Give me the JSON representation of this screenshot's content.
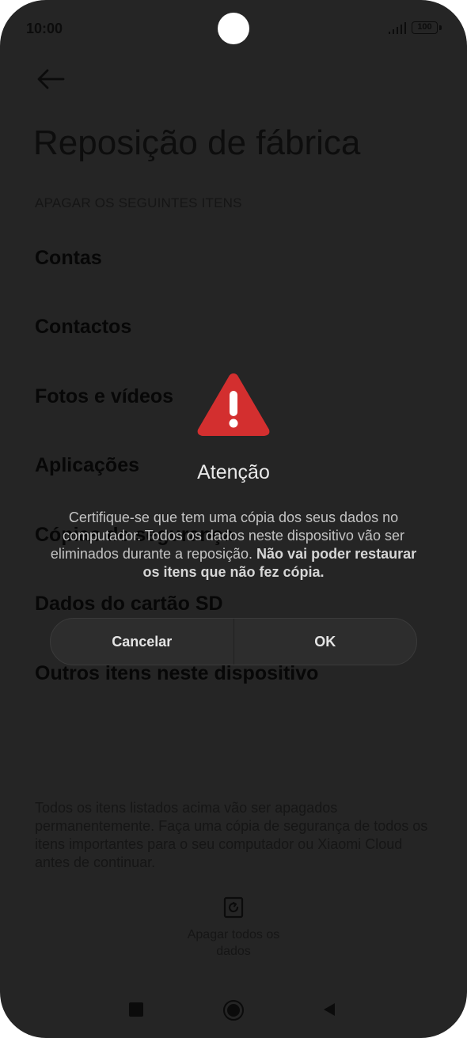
{
  "status_bar": {
    "time": "10:00",
    "battery": "100"
  },
  "page": {
    "title": "Reposição de fábrica",
    "section_header": "APAGAR OS SEGUINTES ITENS",
    "items": [
      "Contas",
      "Contactos",
      "Fotos e vídeos",
      "Aplicações",
      "Cópias de segurança",
      "Dados do cartão SD",
      "Outros itens neste dispositivo"
    ],
    "footer_note": "Todos os itens listados acima vão ser apagados permanentemente. Faça uma cópia de segurança de todos os itens importantes para o seu computador ou Xiaomi Cloud antes de continuar.",
    "erase_button_label": "Apagar todos os dados"
  },
  "dialog": {
    "title": "Atenção",
    "message": "Certifique-se que tem uma cópia dos seus dados no computador. Todos os dados neste dispositivo vão ser eliminados durante a reposição.",
    "message_bold": "Não vai poder restaurar os itens que não fez cópia.",
    "cancel_label": "Cancelar",
    "ok_label": "OK",
    "warning_color": "#d32f2f"
  },
  "icons": {
    "back": "arrow-left-icon",
    "warning": "warning-triangle-icon",
    "erase": "erase-data-icon",
    "nav_recent": "square-icon",
    "nav_home": "circle-icon",
    "nav_back": "triangle-back-icon"
  }
}
